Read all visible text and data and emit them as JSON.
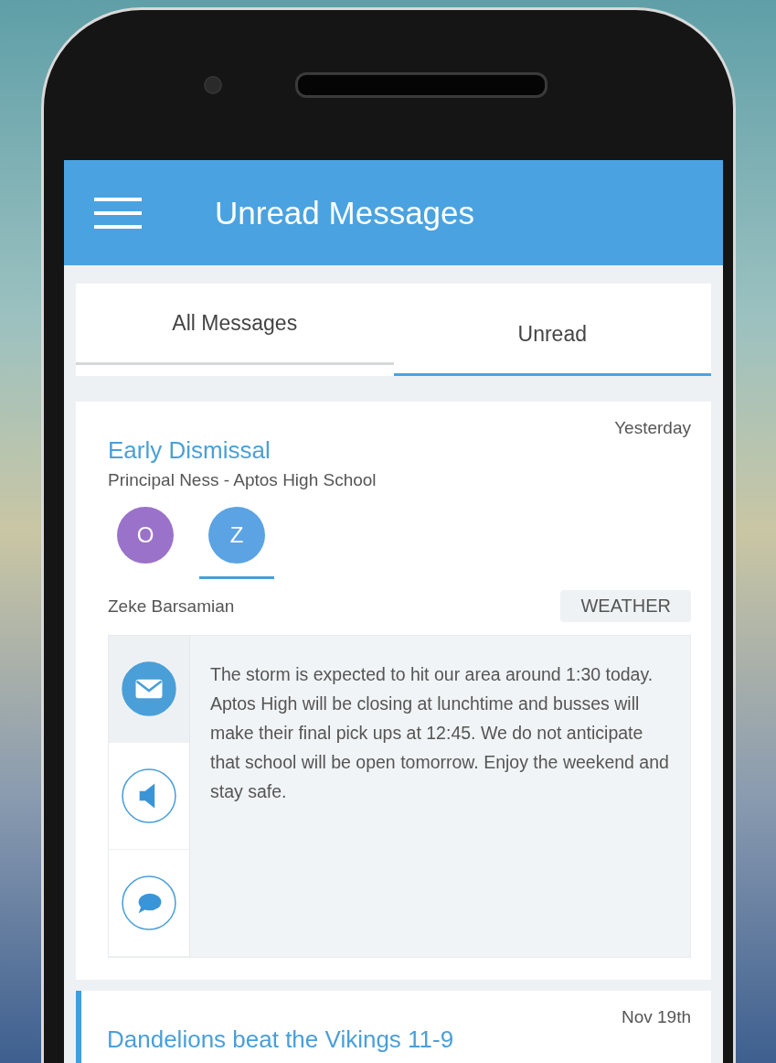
{
  "header": {
    "title": "Unread Messages"
  },
  "tabs": [
    {
      "label": "All Messages",
      "selected": false
    },
    {
      "label": "Unread",
      "selected": true
    }
  ],
  "messages": [
    {
      "title": "Early Dismissal",
      "sender": "Principal Ness - Aptos High School",
      "date": "Yesterday",
      "highlighted": false,
      "recipients": [
        {
          "initial": "O",
          "color": "#9b72c9",
          "selected": false
        },
        {
          "initial": "Z",
          "color": "#5ba3e3",
          "selected": true
        }
      ],
      "recipient_name": "Zeke Barsamian",
      "tag": "WEATHER",
      "channels": [
        {
          "kind": "email",
          "selected": true
        },
        {
          "kind": "voice",
          "selected": false
        },
        {
          "kind": "text",
          "selected": false
        }
      ],
      "body": "The storm is expected to hit our area around 1:30 today. Aptos High will be closing at lunchtime and busses will make their final pick ups at 12:45. We do not anticipate that school will be open tomorrow. Enjoy the weekend and stay safe."
    },
    {
      "title": "Dandelions beat the Vikings 11-9",
      "date": "Nov 19th",
      "highlighted": true
    }
  ]
}
